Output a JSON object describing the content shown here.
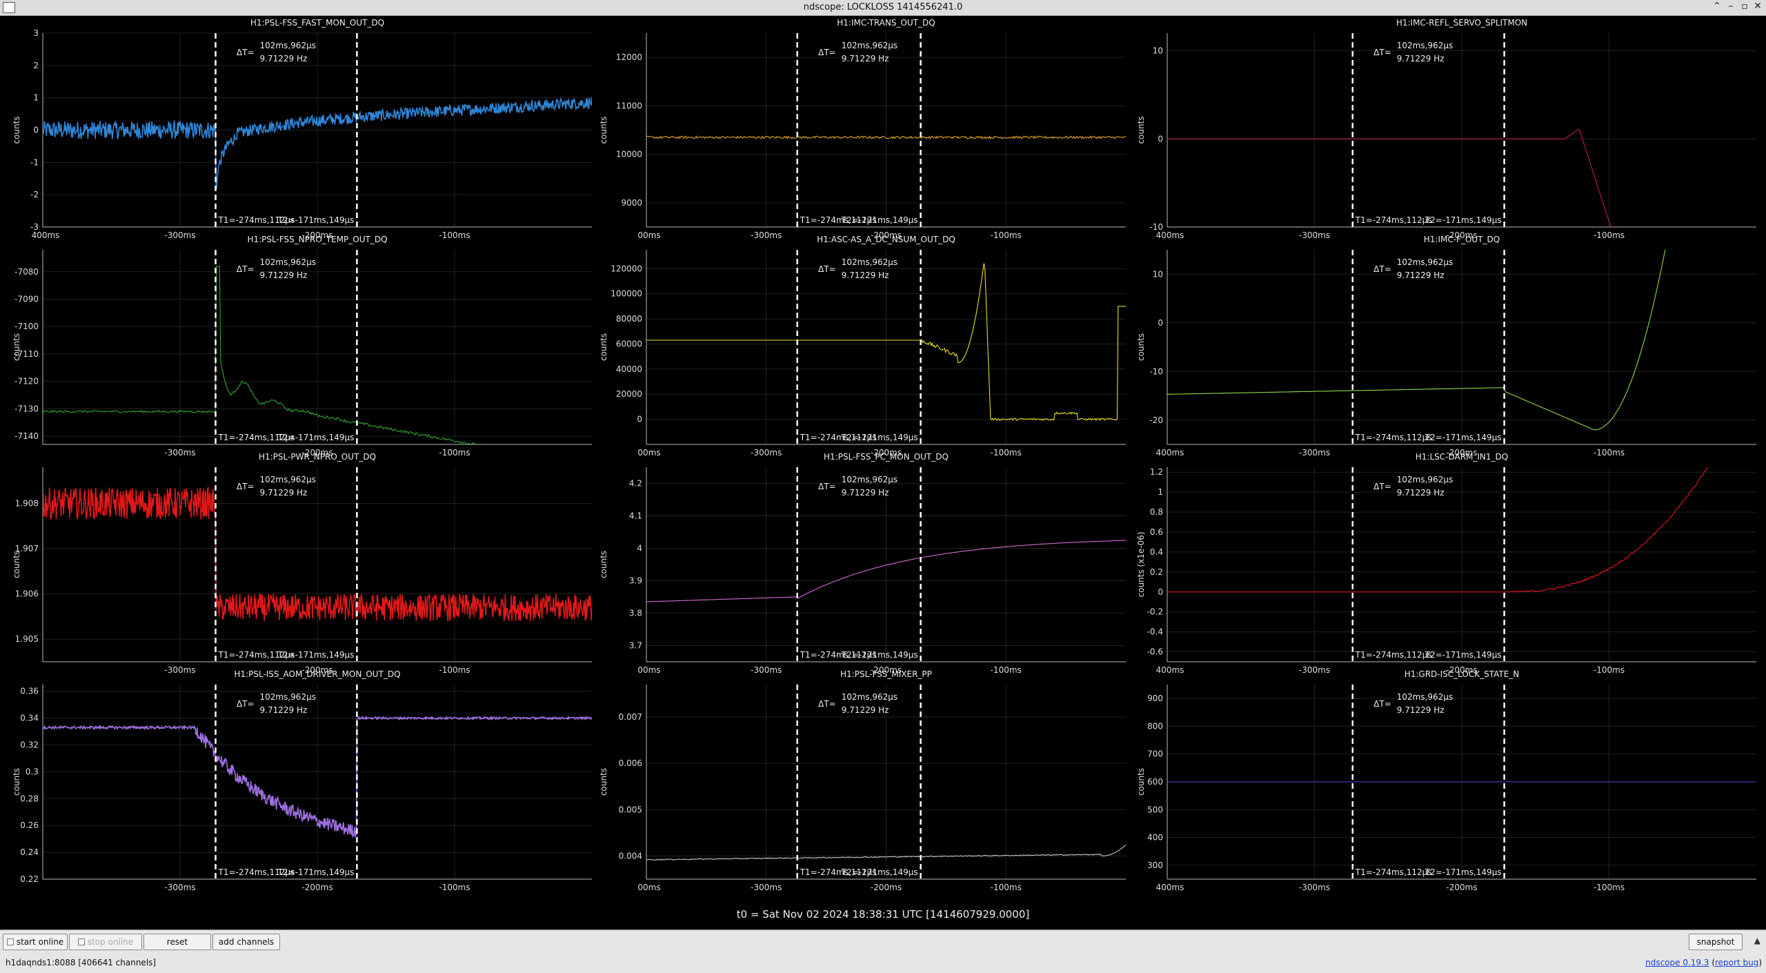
{
  "window": {
    "title": "ndscope: LOCKLOSS 1414556241.0"
  },
  "cursor_common": {
    "dt_label": "ΔT=",
    "dt_value": "102ms,962µs",
    "dt_freq": "9.71229 Hz",
    "t1_label": "T1=-274ms,112µs",
    "t2_label": "T2=-171ms,149µs",
    "t1_ms": -274.112,
    "t2_ms": -171.149
  },
  "x_axis": {
    "range_ms": [
      -400,
      0
    ],
    "ticks": [
      -300,
      -200,
      -100
    ],
    "tick_labels": [
      "-300ms",
      "-200ms",
      "-100ms"
    ],
    "left_labels": [
      "400ms",
      "00ms"
    ]
  },
  "plots": [
    {
      "channel": "H1:PSL-FSS_FAST_MON_OUT_DQ",
      "ylabel": "counts",
      "color": "#2f86d8",
      "ylim": [
        -3,
        3
      ],
      "yticks": [
        "3",
        "2",
        "1",
        "0",
        "-1",
        "-2",
        "-3"
      ],
      "x_left_label": "400ms"
    },
    {
      "channel": "H1:IMC-TRANS_OUT_DQ",
      "ylabel": "counts",
      "color": "#e3a21a",
      "ylim": [
        8500,
        12500
      ],
      "yticks": [
        "12000",
        "11000",
        "10000",
        "9000"
      ],
      "x_left_label": "00ms"
    },
    {
      "channel": "H1:IMC-REFL_SERVO_SPLITMON",
      "ylabel": "counts",
      "color": "#c0185a",
      "ylim": [
        -10,
        12
      ],
      "yticks": [
        "10",
        "0",
        "-10"
      ],
      "x_left_label": "400ms"
    },
    {
      "channel": "H1:PSL-FSS_NPRO_TEMP_OUT_DQ",
      "ylabel": "counts",
      "color": "#2fa62f",
      "ylim": [
        -7143,
        -7072
      ],
      "yticks": [
        "-7080",
        "-7090",
        "-7100",
        "-7110",
        "-7120",
        "-7130",
        "-7140"
      ],
      "x_left_label": ""
    },
    {
      "channel": "H1:ASC-AS_A_DC_NSUM_OUT_DQ",
      "ylabel": "counts",
      "color": "#e6e020",
      "ylim": [
        -20000,
        135000
      ],
      "yticks": [
        "120000",
        "100000",
        "80000",
        "60000",
        "40000",
        "20000",
        "0"
      ],
      "x_left_label": "00ms"
    },
    {
      "channel": "H1:IMC-F_OUT_DQ",
      "ylabel": "counts",
      "color": "#8fdc4a",
      "ylim": [
        -25,
        15
      ],
      "yticks": [
        "10",
        "0",
        "-10",
        "-20"
      ],
      "x_left_label": "400ms"
    },
    {
      "channel": "H1:PSL-PWR_NPRO_OUT_DQ",
      "ylabel": "counts",
      "color": "#e01818",
      "ylim": [
        1.9045,
        1.9088
      ],
      "yticks": [
        "1.908",
        "1.907",
        "1.906",
        "1.905"
      ],
      "x_left_label": ""
    },
    {
      "channel": "H1:PSL-FSS_PC_MON_OUT_DQ",
      "ylabel": "counts",
      "color": "#d36ad3",
      "ylim": [
        3.65,
        4.25
      ],
      "yticks": [
        "4.2",
        "4.1",
        "4",
        "3.9",
        "3.8",
        "3.7"
      ],
      "x_left_label": "00ms"
    },
    {
      "channel": "H1:LSC-DARM_IN1_DQ",
      "ylabel": "counts (x1e-06)",
      "color": "#e01818",
      "ylim": [
        -0.7,
        1.25
      ],
      "yticks": [
        "1.2",
        "1",
        "0.8",
        "0.6",
        "0.4",
        "0.2",
        "0",
        "-0.2",
        "-0.4",
        "-0.6"
      ],
      "x_left_label": "400ms"
    },
    {
      "channel": "H1:PSL-ISS_AOM_DRIVER_MON_OUT_DQ",
      "ylabel": "counts",
      "color": "#a070e0",
      "ylim": [
        0.22,
        0.365
      ],
      "yticks": [
        "0.36",
        "0.34",
        "0.32",
        "0.3",
        "0.28",
        "0.26",
        "0.24",
        "0.22"
      ],
      "x_left_label": ""
    },
    {
      "channel": "H1:PSL-FSS_MIXER_PP",
      "ylabel": "counts",
      "color": "#c8c8c8",
      "ylim": [
        0.0035,
        0.0077
      ],
      "yticks": [
        "0.007",
        "0.006",
        "0.005",
        "0.004"
      ],
      "x_left_label": "00ms"
    },
    {
      "channel": "H1:GRD-ISC_LOCK_STATE_N",
      "ylabel": "counts",
      "color": "#6a3ad8",
      "ylim": [
        250,
        950
      ],
      "yticks": [
        "900",
        "800",
        "700",
        "600",
        "500",
        "400",
        "300"
      ],
      "x_left_label": "400ms"
    }
  ],
  "t0_label": "t0 = Sat Nov 02 2024 18:38:31 UTC [1414607929.0000]",
  "toolbar": {
    "start_online": "start online",
    "stop_online": "stop online",
    "reset": "reset",
    "add_channels": "add channels",
    "snapshot": "snapshot"
  },
  "status": {
    "server": "h1daqnds1:8088",
    "channels": "[406641 channels]"
  },
  "footer": {
    "version": "ndscope 0.19.3",
    "report": "report bug"
  }
}
